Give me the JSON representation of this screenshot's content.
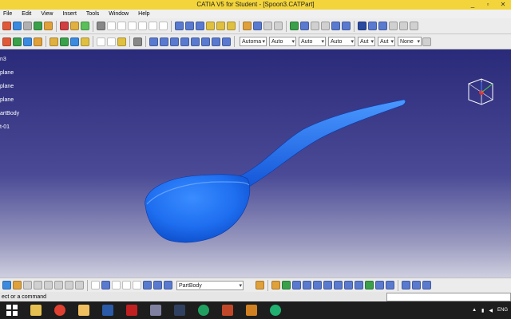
{
  "window": {
    "title": "CATIA V5 for Student - [Spoon3.CATPart]",
    "buttons": [
      "_",
      "▫",
      "✕"
    ]
  },
  "menu": [
    "File",
    "Edit",
    "View",
    "Insert",
    "Tools",
    "Window",
    "Help"
  ],
  "toolbar2_dropdowns": [
    "Automa",
    "Auto",
    "Auto",
    "Auto",
    "Aut",
    "Aut",
    "None"
  ],
  "tree": [
    "n3",
    "plane",
    "plane",
    "plane",
    "artBody",
    "t-01"
  ],
  "bottom_toolbar": {
    "part_select": "PartBody"
  },
  "status": {
    "text": "ect or a command"
  },
  "taskbar": {
    "lang": "ENG"
  },
  "colors": {
    "model": "#1e6ef0",
    "title_bar": "#f3d43a"
  },
  "icons": [
    "sketch-icon",
    "pad-icon",
    "pocket-icon",
    "shaft-icon",
    "groove-icon",
    "hole-icon",
    "rib-icon",
    "slot-icon",
    "fillet-icon",
    "chamfer-icon",
    "draft-icon",
    "shell-icon",
    "thickness-icon",
    "thread-icon",
    "rectangle-icon",
    "circle-icon",
    "save-icon",
    "undo-icon",
    "redo-icon",
    "help-icon",
    "measure-icon",
    "fit-all-icon",
    "pan-icon",
    "rotate-icon",
    "zoom-icon"
  ]
}
